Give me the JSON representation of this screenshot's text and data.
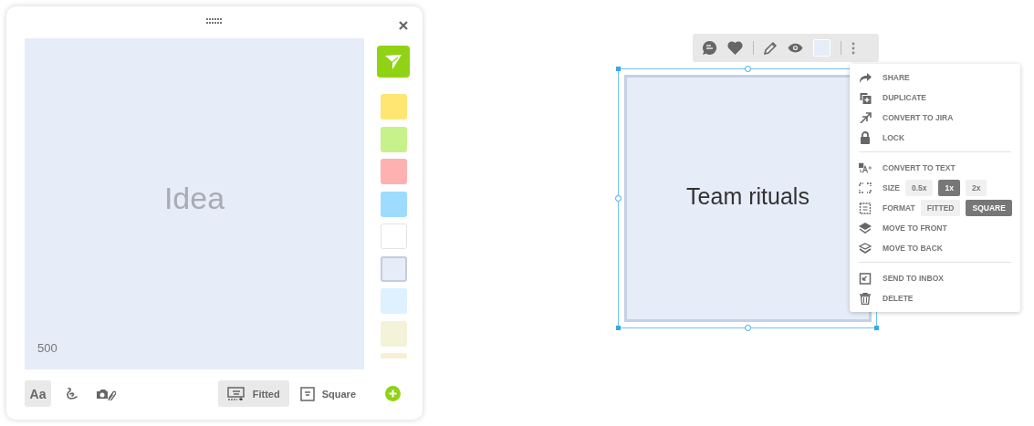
{
  "editor": {
    "placeholder": "Idea",
    "char_count": "500",
    "swatches": [
      {
        "color": "#ffe572",
        "selected": false
      },
      {
        "color": "#c7f18a",
        "selected": false
      },
      {
        "color": "#ffb0b0",
        "selected": false
      },
      {
        "color": "#9ddcff",
        "selected": false
      },
      {
        "color": "#ffffff",
        "selected": false
      },
      {
        "color": "#e6ecf8",
        "selected": true
      },
      {
        "color": "#ddf1ff",
        "selected": false
      },
      {
        "color": "#f4f2d8",
        "selected": false
      },
      {
        "color": "#f7f0d4",
        "selected": false
      }
    ],
    "tools": [
      {
        "kind": "text",
        "label": "Aa",
        "selected": true
      },
      {
        "kind": "draw",
        "selected": false
      },
      {
        "kind": "photo",
        "selected": false
      }
    ],
    "formats": [
      {
        "kind": "fitted",
        "label": "Fitted",
        "selected": true
      },
      {
        "kind": "square",
        "label": "Square",
        "selected": false
      }
    ]
  },
  "canvas": {
    "note": {
      "text": "Team rituals",
      "color": "#e6ecf8",
      "selected": true
    },
    "menu": [
      [
        {
          "kind": "share",
          "label": "SHARE"
        },
        {
          "kind": "duplicate",
          "label": "DUPLICATE"
        },
        {
          "kind": "jira",
          "label": "CONVERT TO JIRA"
        },
        {
          "kind": "lock",
          "label": "LOCK"
        }
      ],
      [
        {
          "kind": "text",
          "label": "CONVERT TO TEXT"
        },
        {
          "kind": "size",
          "label": "SIZE",
          "options": [
            {
              "label": "0.5x",
              "selected": false
            },
            {
              "label": "1x",
              "selected": true
            },
            {
              "label": "2x",
              "selected": false
            }
          ]
        },
        {
          "kind": "format",
          "label": "FORMAT",
          "options": [
            {
              "label": "FITTED",
              "selected": false
            },
            {
              "label": "SQUARE",
              "selected": true
            }
          ]
        },
        {
          "kind": "front",
          "label": "MOVE TO FRONT"
        },
        {
          "kind": "back",
          "label": "MOVE TO BACK"
        }
      ],
      [
        {
          "kind": "inbox",
          "label": "SEND TO INBOX"
        },
        {
          "kind": "delete",
          "label": "DELETE"
        }
      ]
    ]
  }
}
